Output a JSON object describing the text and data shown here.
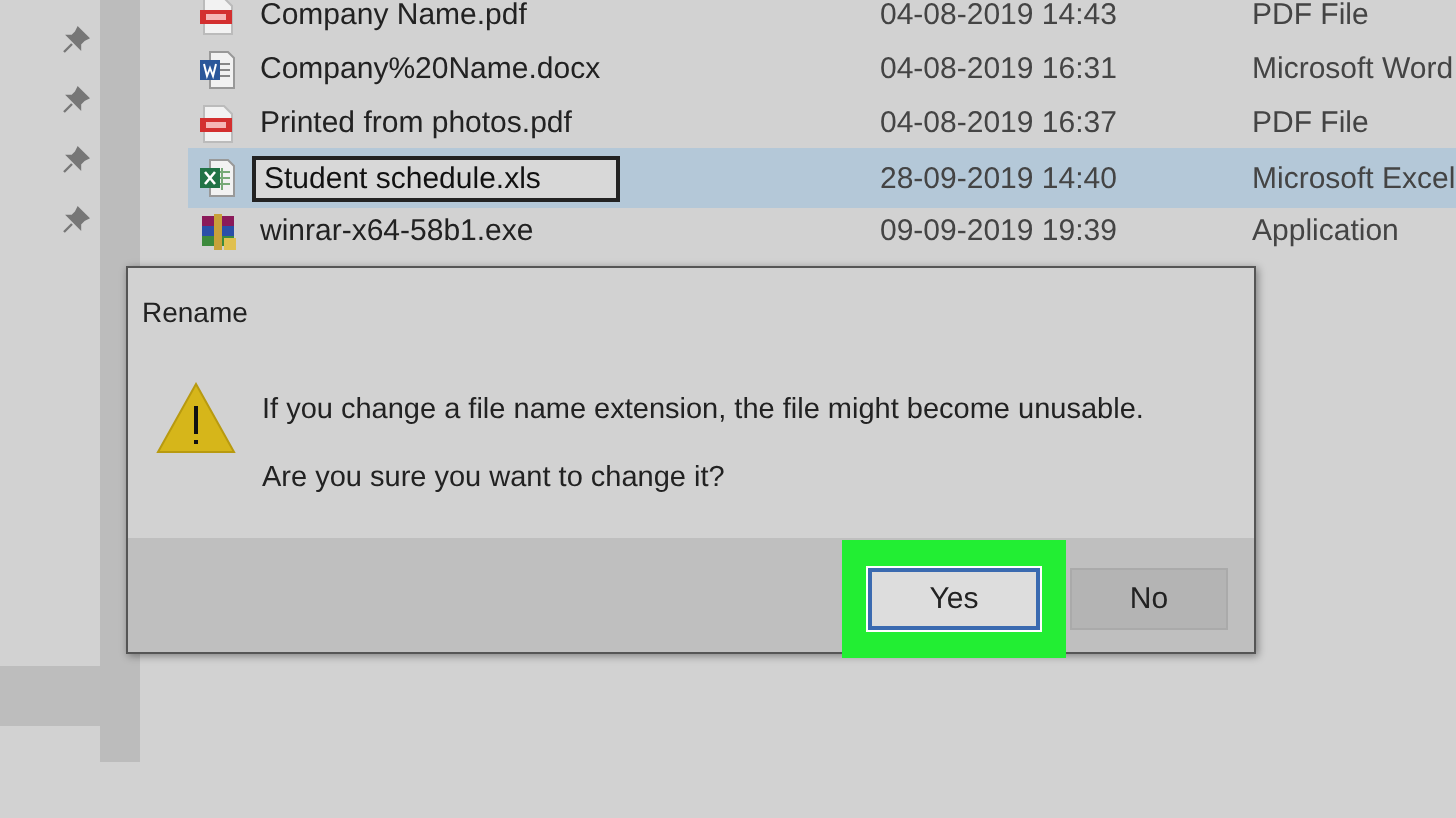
{
  "files": [
    {
      "name": "Company Name.pdf",
      "modified": "04-08-2019 14:43",
      "type": "PDF File",
      "kind": "pdf",
      "selected": false,
      "renaming": false
    },
    {
      "name": "Company%20Name.docx",
      "modified": "04-08-2019 16:31",
      "type": "Microsoft Word",
      "kind": "word",
      "selected": false,
      "renaming": false
    },
    {
      "name": "Printed from photos.pdf",
      "modified": "04-08-2019 16:37",
      "type": "PDF File",
      "kind": "pdf",
      "selected": false,
      "renaming": false
    },
    {
      "name": "Student schedule.xls",
      "modified": "28-09-2019 14:40",
      "type": "Microsoft Excel",
      "kind": "excel",
      "selected": true,
      "renaming": true
    },
    {
      "name": "winrar-x64-58b1.exe",
      "modified": "09-09-2019 19:39",
      "type": "Application",
      "kind": "exe",
      "selected": false,
      "renaming": false
    }
  ],
  "dialog": {
    "title": "Rename",
    "message": "If you change a file name extension, the file might become unusable.",
    "question": "Are you sure you want to change it?",
    "buttons": [
      {
        "label": "Yes",
        "highlighted": true
      },
      {
        "label": "No",
        "highlighted": false
      }
    ]
  }
}
